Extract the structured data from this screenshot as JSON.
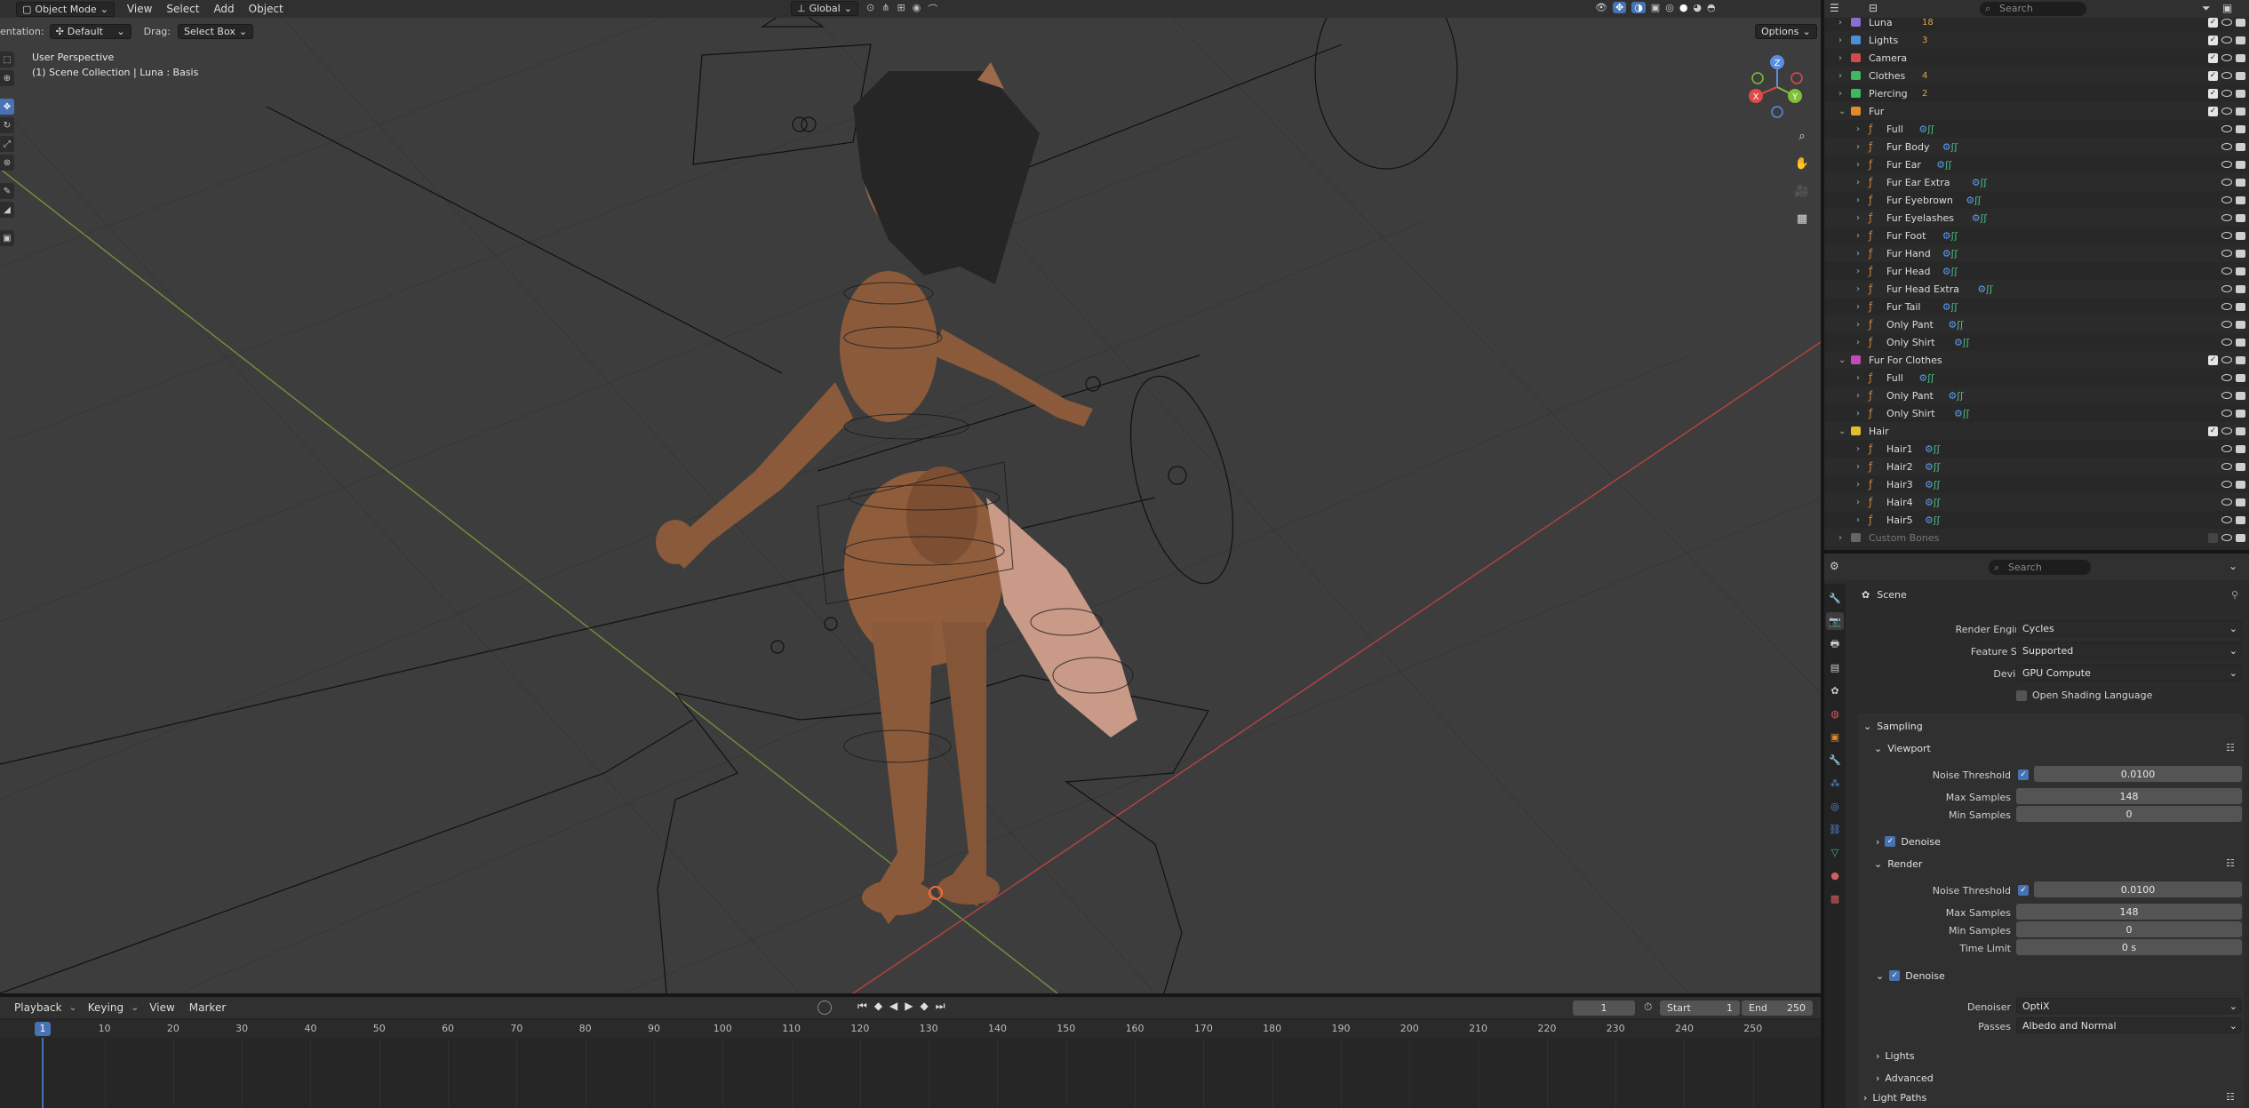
{
  "header": {
    "mode": "Object Mode",
    "menus": [
      "View",
      "Select",
      "Add",
      "Object"
    ],
    "orientation_label": "entation:",
    "orientation_value": "Default",
    "drag_label": "Drag:",
    "drag_value": "Select Box",
    "transform_orientation": "Global",
    "options": "Options"
  },
  "viewport": {
    "perspective": "User Perspective",
    "collection": "(1) Scene Collection | Luna : Basis",
    "gizmo": {
      "z": "Z",
      "y": "Y",
      "x": "X"
    }
  },
  "outliner": {
    "search_placeholder": "Search",
    "rows": [
      {
        "name": "Luna",
        "type": "collection",
        "color": "#8a6fd1",
        "extra": "18",
        "indent": 0
      },
      {
        "name": "Lights",
        "type": "collection",
        "color": "#4b8fd6",
        "extra": "3",
        "indent": 0
      },
      {
        "name": "Camera",
        "type": "collection",
        "color": "#d24a4a",
        "extra": "",
        "indent": 0
      },
      {
        "name": "Clothes",
        "type": "collection",
        "color": "#3fb95f",
        "extra": "4",
        "indent": 0
      },
      {
        "name": "Piercing",
        "type": "collection",
        "color": "#3fb95f",
        "extra": "2",
        "indent": 0
      },
      {
        "name": "Fur",
        "type": "collection",
        "color": "#e08a2c",
        "extra": "",
        "indent": 0,
        "open": true
      },
      {
        "name": "Full",
        "type": "hair",
        "indent": 1
      },
      {
        "name": "Fur Body",
        "type": "hair",
        "indent": 1
      },
      {
        "name": "Fur Ear",
        "type": "hair",
        "indent": 1
      },
      {
        "name": "Fur Ear Extra",
        "type": "hair",
        "indent": 1
      },
      {
        "name": "Fur Eyebrown",
        "type": "hair",
        "indent": 1
      },
      {
        "name": "Fur Eyelashes",
        "type": "hair",
        "indent": 1
      },
      {
        "name": "Fur Foot",
        "type": "hair",
        "indent": 1
      },
      {
        "name": "Fur Hand",
        "type": "hair",
        "indent": 1
      },
      {
        "name": "Fur Head",
        "type": "hair",
        "indent": 1
      },
      {
        "name": "Fur Head Extra",
        "type": "hair",
        "indent": 1
      },
      {
        "name": "Fur Tail",
        "type": "hair",
        "indent": 1
      },
      {
        "name": "Only Pant",
        "type": "hair",
        "indent": 1
      },
      {
        "name": "Only Shirt",
        "type": "hair",
        "indent": 1
      },
      {
        "name": "Fur For Clothes",
        "type": "collection",
        "color": "#c04bb8",
        "extra": "",
        "indent": 0,
        "open": true
      },
      {
        "name": "Full",
        "type": "hair",
        "indent": 1
      },
      {
        "name": "Only Pant",
        "type": "hair",
        "indent": 1
      },
      {
        "name": "Only Shirt",
        "type": "hair",
        "indent": 1
      },
      {
        "name": "Hair",
        "type": "collection",
        "color": "#e0c02c",
        "extra": "",
        "indent": 0,
        "open": true
      },
      {
        "name": "Hair1",
        "type": "hair",
        "indent": 1
      },
      {
        "name": "Hair2",
        "type": "hair",
        "indent": 1
      },
      {
        "name": "Hair3",
        "type": "hair",
        "indent": 1
      },
      {
        "name": "Hair4",
        "type": "hair",
        "indent": 1
      },
      {
        "name": "Hair5",
        "type": "hair",
        "indent": 1
      },
      {
        "name": "Custom Bones",
        "type": "collection",
        "color": "#666666",
        "extra": "",
        "indent": 0,
        "dim": true
      }
    ]
  },
  "properties": {
    "search_placeholder": "Search",
    "context": "Scene",
    "render_engine_label": "Render Engine",
    "render_engine": "Cycles",
    "feature_set_label": "Feature Set",
    "feature_set": "Supported",
    "device_label": "Device",
    "device": "GPU Compute",
    "osl_label": "Open Shading Language",
    "sampling": "Sampling",
    "viewport_panel": "Viewport",
    "noise_threshold_label": "Noise Threshold",
    "vp_noise": "0.0100",
    "max_samples_label": "Max Samples",
    "vp_max": "148",
    "min_samples_label": "Min Samples",
    "vp_min": "0",
    "denoise_label": "Denoise",
    "render_panel": "Render",
    "r_noise": "0.0100",
    "r_max": "148",
    "r_min": "0",
    "time_limit_label": "Time Limit",
    "r_time": "0 s",
    "denoiser_label": "Denoiser",
    "denoiser": "OptiX",
    "passes_label": "Passes",
    "passes": "Albedo and Normal",
    "lights": "Lights",
    "advanced": "Advanced",
    "light_paths": "Light Paths"
  },
  "timeline": {
    "menus": [
      "Playback",
      "Keying",
      "View",
      "Marker"
    ],
    "current_frame": "1",
    "start_label": "Start",
    "start": "1",
    "end_label": "End",
    "end": "250",
    "playhead": "1",
    "ticks": [
      "10",
      "20",
      "30",
      "40",
      "50",
      "60",
      "70",
      "80",
      "90",
      "100",
      "110",
      "120",
      "130",
      "140",
      "150",
      "160",
      "170",
      "180",
      "190",
      "200",
      "210",
      "220",
      "230",
      "240",
      "250"
    ]
  }
}
